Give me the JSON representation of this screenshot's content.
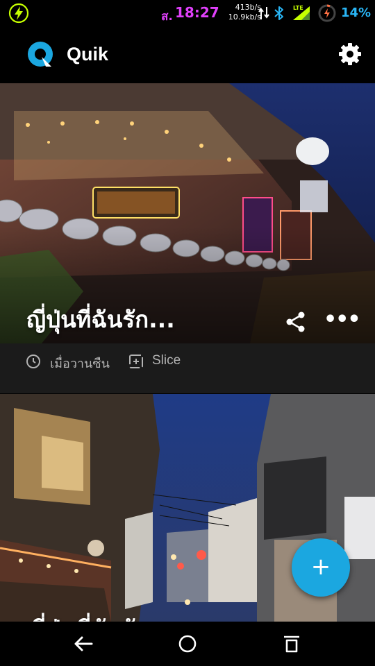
{
  "status_bar": {
    "carrier_char": "ส.",
    "time": "18:27",
    "speed_up": "413b/s",
    "speed_down": "10.9kb/s",
    "network": "LTE",
    "battery_percent": "14%",
    "icons": [
      "bolt-icon",
      "data-arrows-icon",
      "bluetooth-icon",
      "lte-signal-icon",
      "battery-saver-icon"
    ]
  },
  "app_bar": {
    "title": "Quik",
    "logo_icon": "quik-logo-icon",
    "settings_icon": "gear-icon"
  },
  "feed": {
    "cards": [
      {
        "title": "ญี่ปุ่นที่ฉันรัก...",
        "time": "เมื่อวานซืน",
        "type": "Slice",
        "image": "night street with illuminated restaurant signs"
      },
      {
        "title": "ญี่ปุ่นที่ฉันรัก...",
        "image": "night alley with lit shops and overhead wires"
      }
    ]
  },
  "fab": {
    "label": "+",
    "icon": "add-icon"
  },
  "nav_bar": {
    "icons": [
      "back-icon",
      "home-icon",
      "recent-apps-icon"
    ]
  },
  "colors": {
    "background": "#000000",
    "card_bg": "#1b1b1b",
    "accent": "#1ba7e0",
    "clock_purple": "#e040fb",
    "battery_blue": "#29b6f6",
    "meta_gray": "#b3b3b3"
  }
}
